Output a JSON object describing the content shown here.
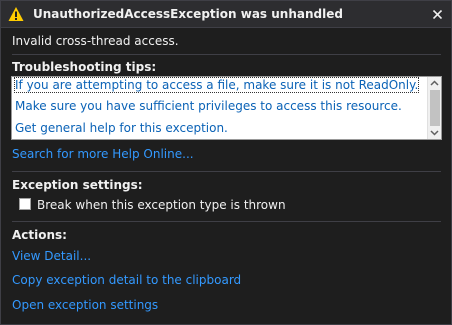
{
  "window": {
    "title": "UnauthorizedAccessException was unhandled",
    "icon": "warning-icon",
    "close_icon": "close-icon"
  },
  "message": "Invalid cross-thread access.",
  "troubleshooting": {
    "heading": "Troubleshooting tips:",
    "tips": [
      "If you are attempting to access a file, make sure it is not ReadOnly.",
      "Make sure you have sufficient privileges to access this resource.",
      "Get general help for this exception."
    ],
    "search_link": "Search for more Help Online..."
  },
  "exception_settings": {
    "heading": "Exception settings:",
    "break_checkbox_label": "Break when this exception type is thrown",
    "break_checked": false
  },
  "actions": {
    "heading": "Actions:",
    "links": [
      "View Detail...",
      "Copy exception detail to the clipboard",
      "Open exception settings"
    ]
  },
  "colors": {
    "background": "#1e1e1e",
    "titlebar": "#2d2d30",
    "text": "#f1f1f1",
    "link": "#3399ff",
    "tip_link": "#0a62b6",
    "warning": "#ffcc00"
  }
}
